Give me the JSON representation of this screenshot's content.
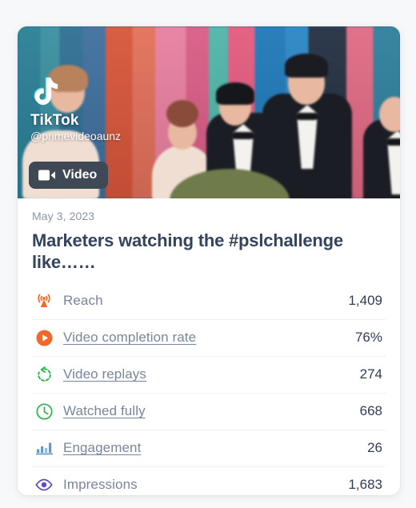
{
  "card": {
    "thumbnail": {
      "platform_name": "TikTok",
      "handle": "@primevideoaunz",
      "badge_label": "Video",
      "badge_icon": "video-camera-icon",
      "logo_icon": "tiktok-logo-icon"
    },
    "date": "May 3, 2023",
    "title": "Marketers watching the #pslchallenge like……",
    "metrics": [
      {
        "icon": "reach-broadcast-icon",
        "label": "Reach",
        "value": "1,409",
        "link": false,
        "color": "#f4672a"
      },
      {
        "icon": "play-circle-icon",
        "label": "Video completion rate",
        "value": "76%",
        "link": true,
        "color": "#f4672a"
      },
      {
        "icon": "replay-arrow-icon",
        "label": "Video replays",
        "value": "274",
        "link": true,
        "color": "#2bb24c"
      },
      {
        "icon": "clock-icon",
        "label": "Watched fully",
        "value": "668",
        "link": true,
        "color": "#2bb24c"
      },
      {
        "icon": "bar-chart-icon",
        "label": "Engagement",
        "value": "26",
        "link": true,
        "color": "#5b9bd5"
      },
      {
        "icon": "eye-icon",
        "label": "Impressions",
        "value": "1,683",
        "link": false,
        "color": "#5b4bc4"
      }
    ]
  },
  "theme": {
    "page_background": "#f7f8fa",
    "card_background": "#ffffff",
    "title_color": "#34445c",
    "label_color": "#78869a",
    "value_color": "#2e3e55",
    "date_color": "#8c96a5",
    "divider_color": "#eef2f6",
    "badge_background": "#3f4855"
  }
}
